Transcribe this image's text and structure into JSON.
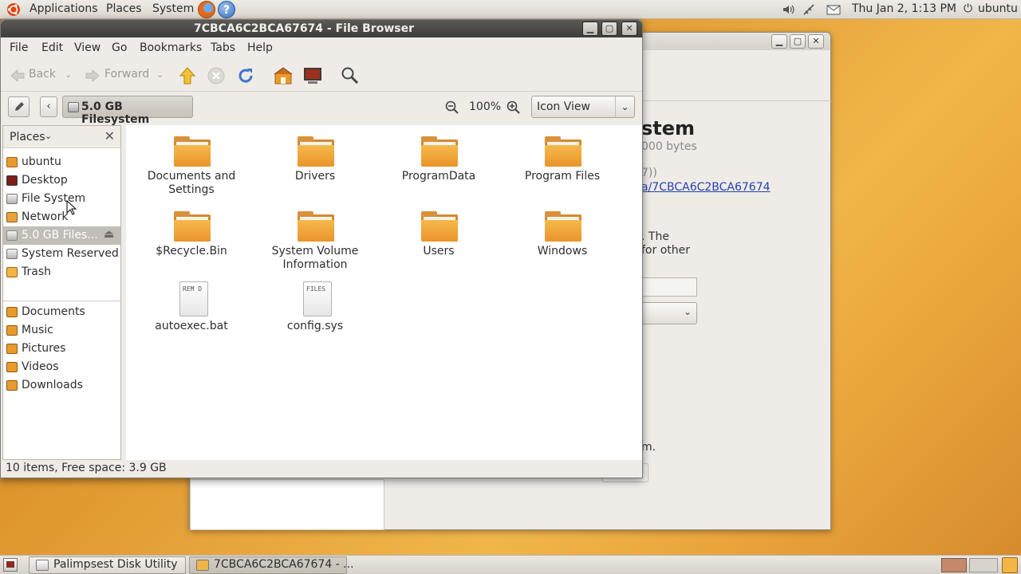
{
  "top_panel": {
    "menus": [
      "Applications",
      "Places",
      "System"
    ],
    "clock": "Thu Jan  2,  1:13 PM",
    "user": "ubuntu"
  },
  "disk_utility": {
    "heading": "stem",
    "bytes": "000 bytes",
    "partial": "7))",
    "link": "a/7CBCA6C2BCA67674",
    "desc_line1": ". The",
    "desc_line2": "for other",
    "tail": "m."
  },
  "file_browser": {
    "title": "7CBCA6C2BCA67674 - File Browser",
    "menu": [
      "File",
      "Edit",
      "View",
      "Go",
      "Bookmarks",
      "Tabs",
      "Help"
    ],
    "toolbar": {
      "back": "Back",
      "forward": "Forward"
    },
    "path_button": "5.0 GB Filesystem",
    "zoom": "100%",
    "view_mode": "Icon View",
    "sidebar": {
      "header": "Places",
      "places": [
        "ubuntu",
        "Desktop",
        "File System",
        "Network",
        "5.0 GB Files...",
        "System Reserved",
        "Trash"
      ],
      "bookmarks": [
        "Documents",
        "Music",
        "Pictures",
        "Videos",
        "Downloads"
      ]
    },
    "files": [
      {
        "name": "Documents and\nSettings",
        "type": "folder"
      },
      {
        "name": "Drivers",
        "type": "folder"
      },
      {
        "name": "ProgramData",
        "type": "folder"
      },
      {
        "name": "Program Files",
        "type": "folder"
      },
      {
        "name": "$Recycle.Bin",
        "type": "folder"
      },
      {
        "name": "System Volume\nInformation",
        "type": "folder"
      },
      {
        "name": "Users",
        "type": "folder"
      },
      {
        "name": "Windows",
        "type": "folder"
      },
      {
        "name": "autoexec.bat",
        "type": "file",
        "preview": "REM D"
      },
      {
        "name": "config.sys",
        "type": "file",
        "preview": "FILES"
      }
    ],
    "status": "10 items, Free space: 3.9 GB"
  },
  "taskbar": {
    "tasks": [
      "Palimpsest Disk Utility",
      "7CBCA6C2BCA67674 - ..."
    ]
  }
}
